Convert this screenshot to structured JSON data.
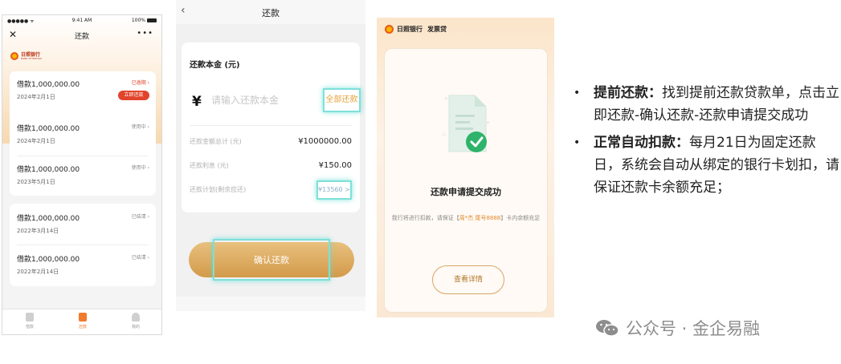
{
  "phone1": {
    "status": {
      "carrier": "●●●●● ᯤ",
      "time": "9:41 AM",
      "battery": "100%"
    },
    "nav": {
      "close": "✕",
      "title": "还款",
      "more": "•••"
    },
    "bank": {
      "name": "日照银行",
      "sub": "BANK OF RIZHAO"
    },
    "loans": [
      {
        "amount": "借款1,000,000.00",
        "date": "2024年2月1日",
        "status": "已逾期 ›",
        "action": "立即还款"
      },
      {
        "amount": "借款1,000,000.00",
        "date": "2024年2月1日",
        "status": "使用中 ›"
      },
      {
        "amount": "借款1,000,000.00",
        "date": "2023年5月1日",
        "status": "使用中 ›"
      },
      {
        "amount": "借款1,000,000.00",
        "date": "2022年3月14日",
        "status": "已结清 ›"
      },
      {
        "amount": "借款1,000,000.00",
        "date": "2022年2月14日",
        "status": "已结清 ›"
      }
    ],
    "tabs": [
      {
        "label": "借款"
      },
      {
        "label": "还款"
      },
      {
        "label": "我的"
      }
    ]
  },
  "phone2": {
    "nav": {
      "back": "‹",
      "title": "还款"
    },
    "principal_label": "还款本金 (元)",
    "yen": "¥",
    "amount_placeholder": "请输入还款本金",
    "all_button": "全部还款",
    "rows": [
      {
        "key": "还款金额总计 (元)",
        "value": "¥1000000.00"
      },
      {
        "key": "还款利息 (元)",
        "value": "¥150.00"
      },
      {
        "key": "还款计划(剩余应还)",
        "value": "¥13560 >"
      }
    ],
    "confirm": "确认还款"
  },
  "phone3": {
    "bank_name": "日照银行",
    "product": "发票贷",
    "title": "还款申请提交成功",
    "msg_prefix": "我行将进行扣款，请保证【",
    "msg_highlight": "周*杰 尾号8888",
    "msg_suffix": "】卡内余额充足",
    "detail_button": "查看详情"
  },
  "notes": [
    {
      "bullet": "•",
      "title": "提前还款：",
      "text": "找到提前还款贷款单，点击立即还款-确认还款-还款申请提交成功"
    },
    {
      "bullet": "•",
      "title": "正常自动扣款：",
      "text": "每月21日为固定还款日，系统会自动从绑定的银行卡划扣，请保证还款卡余额充足；"
    }
  ],
  "watermark": "公众号 · 金企易融",
  "colors": {
    "accent_red": "#e2432c",
    "gold": "#d39a4a",
    "highlight": "#7ee0d9",
    "orange": "#e28b2f"
  }
}
